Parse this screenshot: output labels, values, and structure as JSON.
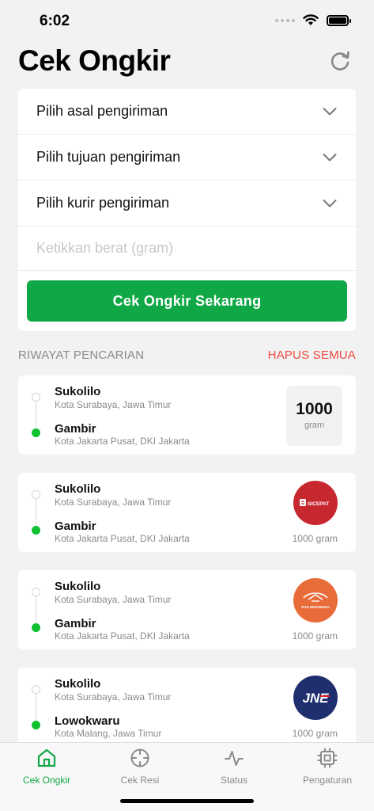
{
  "status": {
    "time": "6:02"
  },
  "header": {
    "title": "Cek Ongkir"
  },
  "form": {
    "origin_label": "Pilih asal pengiriman",
    "destination_label": "Pilih tujuan pengiriman",
    "courier_label": "Pilih kurir pengiriman",
    "weight_placeholder": "Ketikkan berat (gram)",
    "submit_label": "Cek Ongkir Sekarang"
  },
  "history": {
    "title": "RIWAYAT PENCARIAN",
    "clear_all": "HAPUS SEMUA",
    "items": [
      {
        "origin": "Sukolilo",
        "origin_sub": "Kota Surabaya, Jawa Timur",
        "dest": "Gambir",
        "dest_sub": "Kota Jakarta Pusat, DKI Jakarta",
        "weight_num": "1000",
        "weight_unit": "gram",
        "courier": "none"
      },
      {
        "origin": "Sukolilo",
        "origin_sub": "Kota Surabaya, Jawa Timur",
        "dest": "Gambir",
        "dest_sub": "Kota Jakarta Pusat, DKI Jakarta",
        "weight": "1000 gram",
        "courier": "sicepat",
        "logo_text": "SICEPAT",
        "logo_color": "#c7272e"
      },
      {
        "origin": "Sukolilo",
        "origin_sub": "Kota Surabaya, Jawa Timur",
        "dest": "Gambir",
        "dest_sub": "Kota Jakarta Pusat, DKI Jakarta",
        "weight": "1000 gram",
        "courier": "pos-indonesia",
        "logo_text": "POS INDONESIA",
        "logo_color": "#e86b3a"
      },
      {
        "origin": "Sukolilo",
        "origin_sub": "Kota Surabaya, Jawa Timur",
        "dest": "Lowokwaru",
        "dest_sub": "Kota Malang, Jawa Timur",
        "weight": "1000 gram",
        "courier": "jne",
        "logo_text": "JNE",
        "logo_color": "#1f2e6e"
      }
    ]
  },
  "tabs": [
    {
      "label": "Cek Ongkir",
      "icon": "home-icon",
      "active": true
    },
    {
      "label": "Cek Resi",
      "icon": "crosshair-icon",
      "active": false
    },
    {
      "label": "Status",
      "icon": "activity-icon",
      "active": false
    },
    {
      "label": "Pengaturan",
      "icon": "cpu-icon",
      "active": false
    }
  ],
  "colors": {
    "accent": "#10a846",
    "danger": "#f04a3f",
    "dest_dot": "#10c232"
  }
}
